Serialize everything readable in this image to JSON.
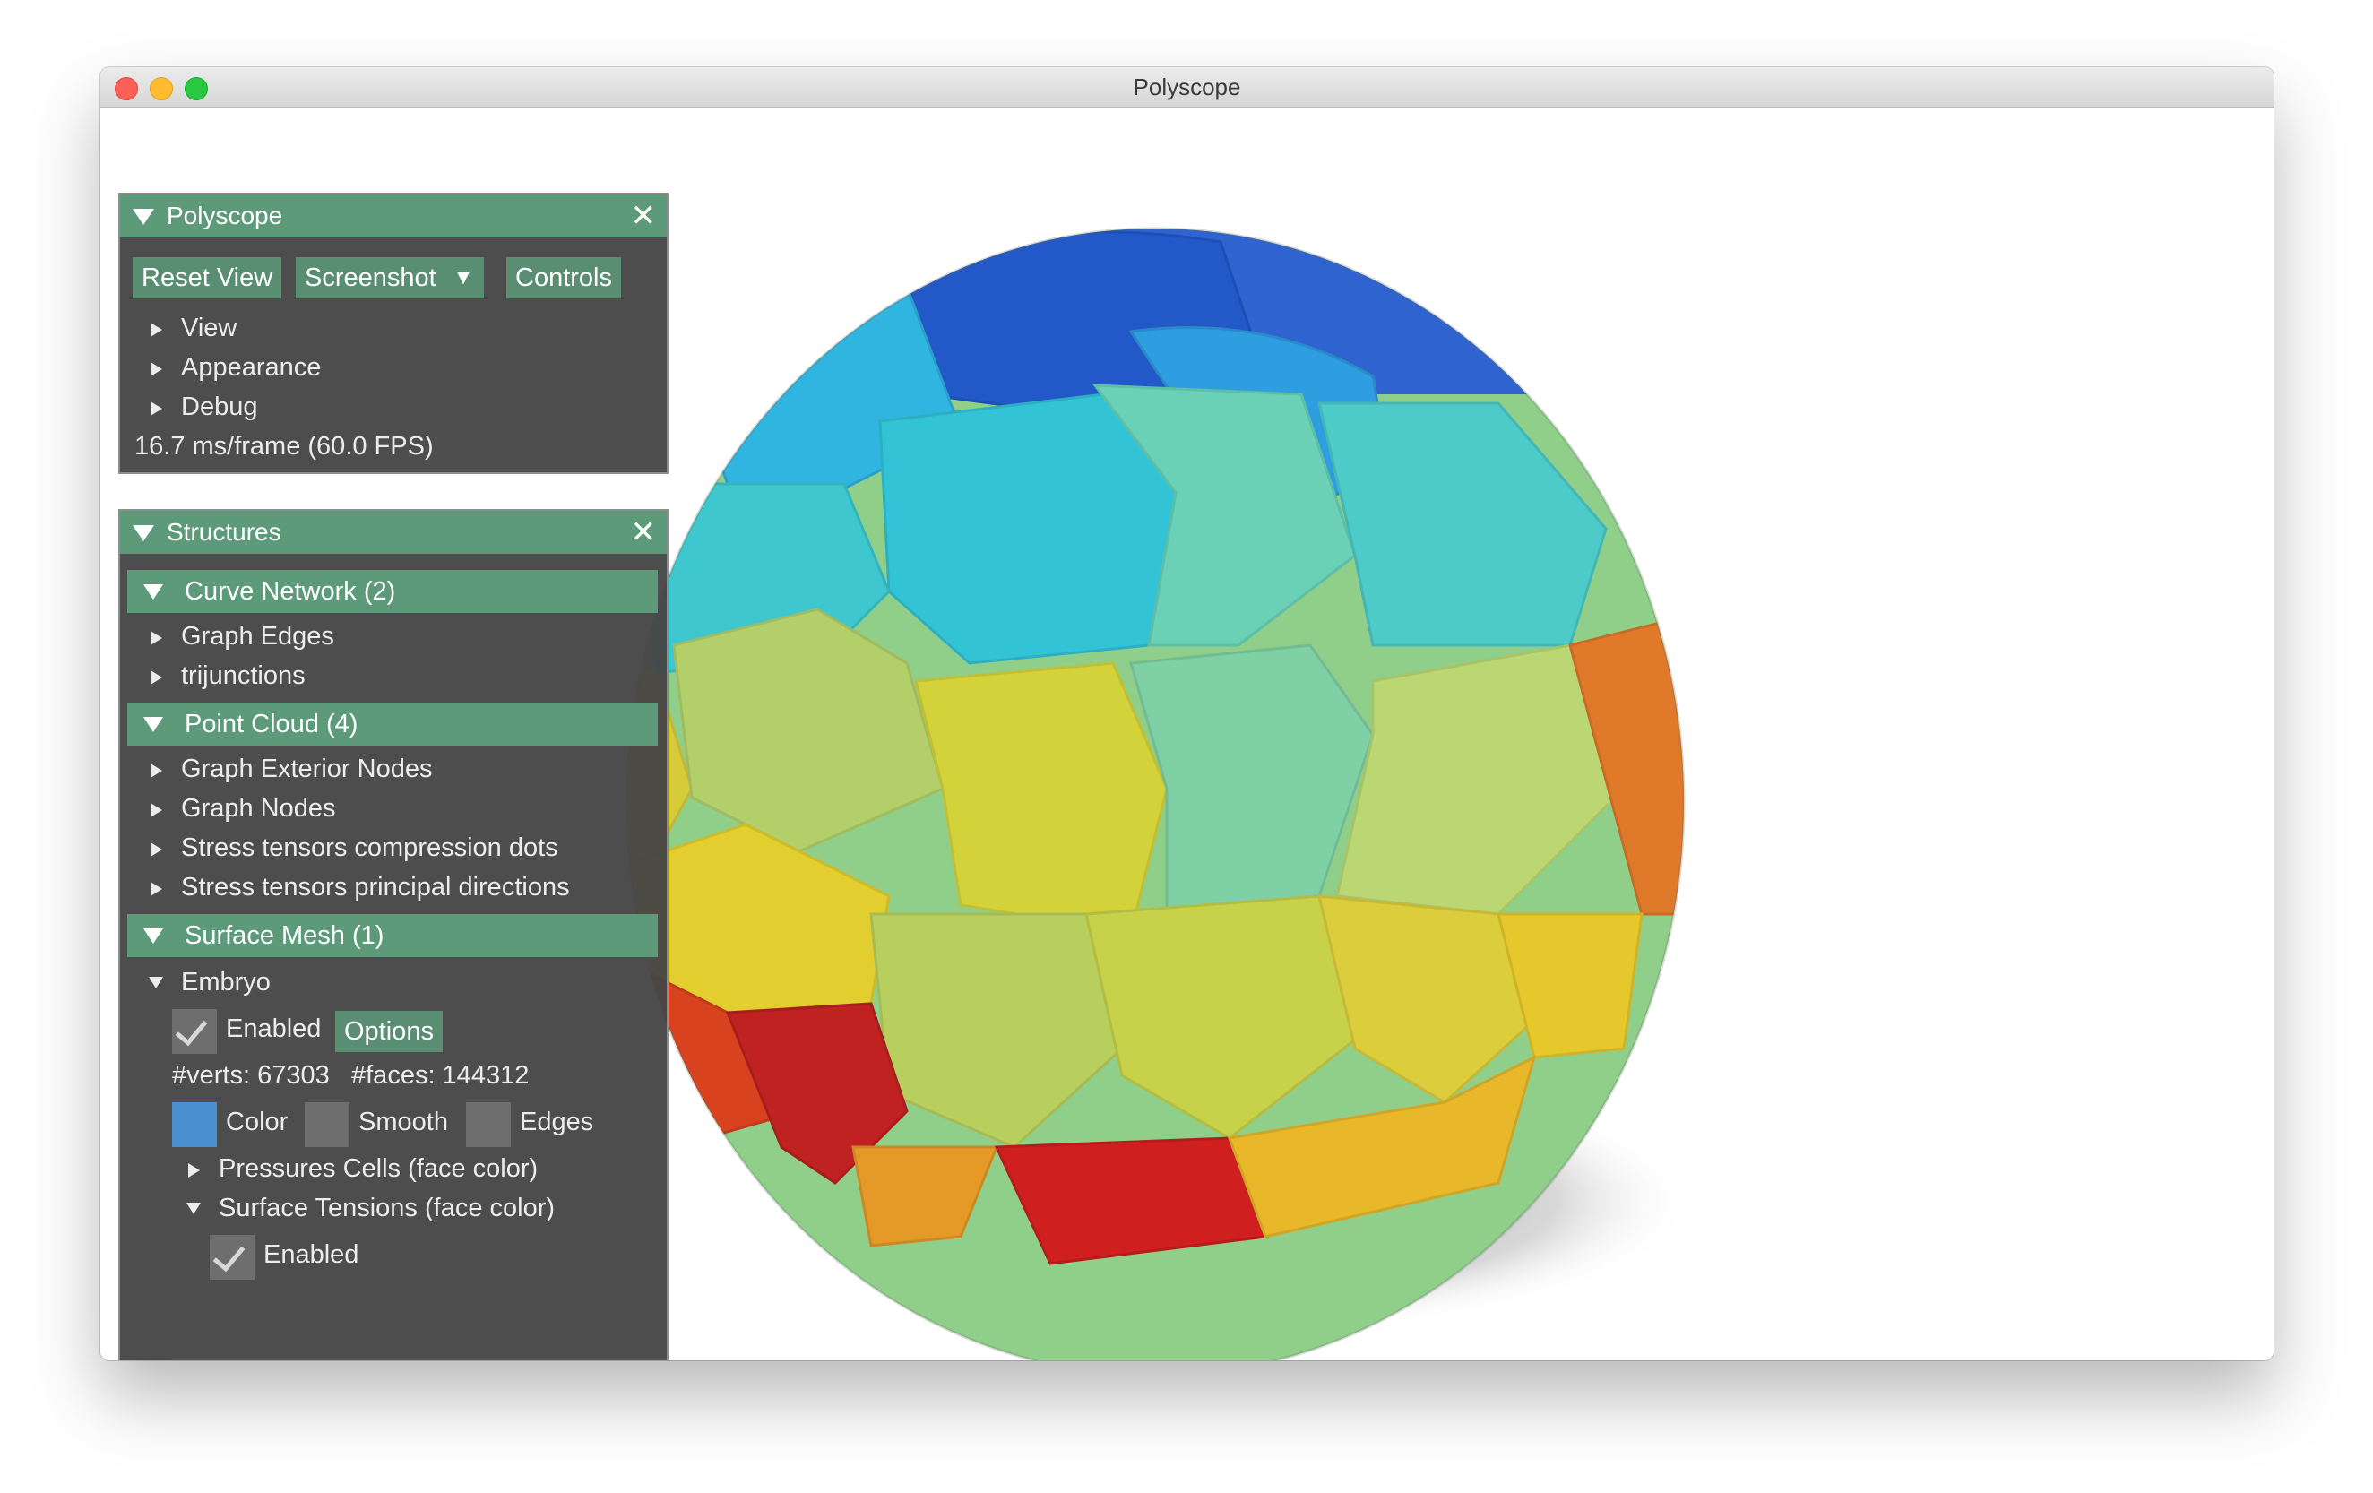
{
  "window": {
    "title": "Polyscope"
  },
  "polyscope_panel": {
    "title": "Polyscope",
    "close_glyph": "✕",
    "buttons": {
      "reset_view": "Reset View",
      "screenshot": "Screenshot",
      "screenshot_menu": "▼",
      "controls": "Controls"
    },
    "items": [
      "View",
      "Appearance",
      "Debug"
    ],
    "fps": "16.7 ms/frame (60.0 FPS)"
  },
  "structures_panel": {
    "title": "Structures",
    "close_glyph": "✕",
    "curve_network": {
      "header": "Curve Network (2)",
      "items": [
        "Graph Edges",
        "trijunctions"
      ]
    },
    "point_cloud": {
      "header": "Point Cloud (4)",
      "items": [
        "Graph Exterior Nodes",
        "Graph Nodes",
        "Stress tensors compression dots",
        "Stress tensors principal directions"
      ]
    },
    "surface_mesh": {
      "header": "Surface Mesh (1)",
      "embryo": {
        "name": "Embryo",
        "enabled_label": "Enabled",
        "enabled": true,
        "options_label": "Options",
        "verts_label": "#verts: 67303",
        "faces_label": "#faces: 144312",
        "color_label": "Color",
        "color": "#4a8fcf",
        "smooth_label": "Smooth",
        "edges_label": "Edges",
        "quantities": [
          {
            "label": "Pressures Cells (face color)",
            "expanded": false
          },
          {
            "label": "Surface Tensions (face color)",
            "expanded": true,
            "enabled_label": "Enabled",
            "enabled": true
          }
        ]
      }
    }
  },
  "colors": {
    "header_green": "#5c9a79",
    "button_green": "#5a8e72",
    "panel_bg": "#464646"
  }
}
